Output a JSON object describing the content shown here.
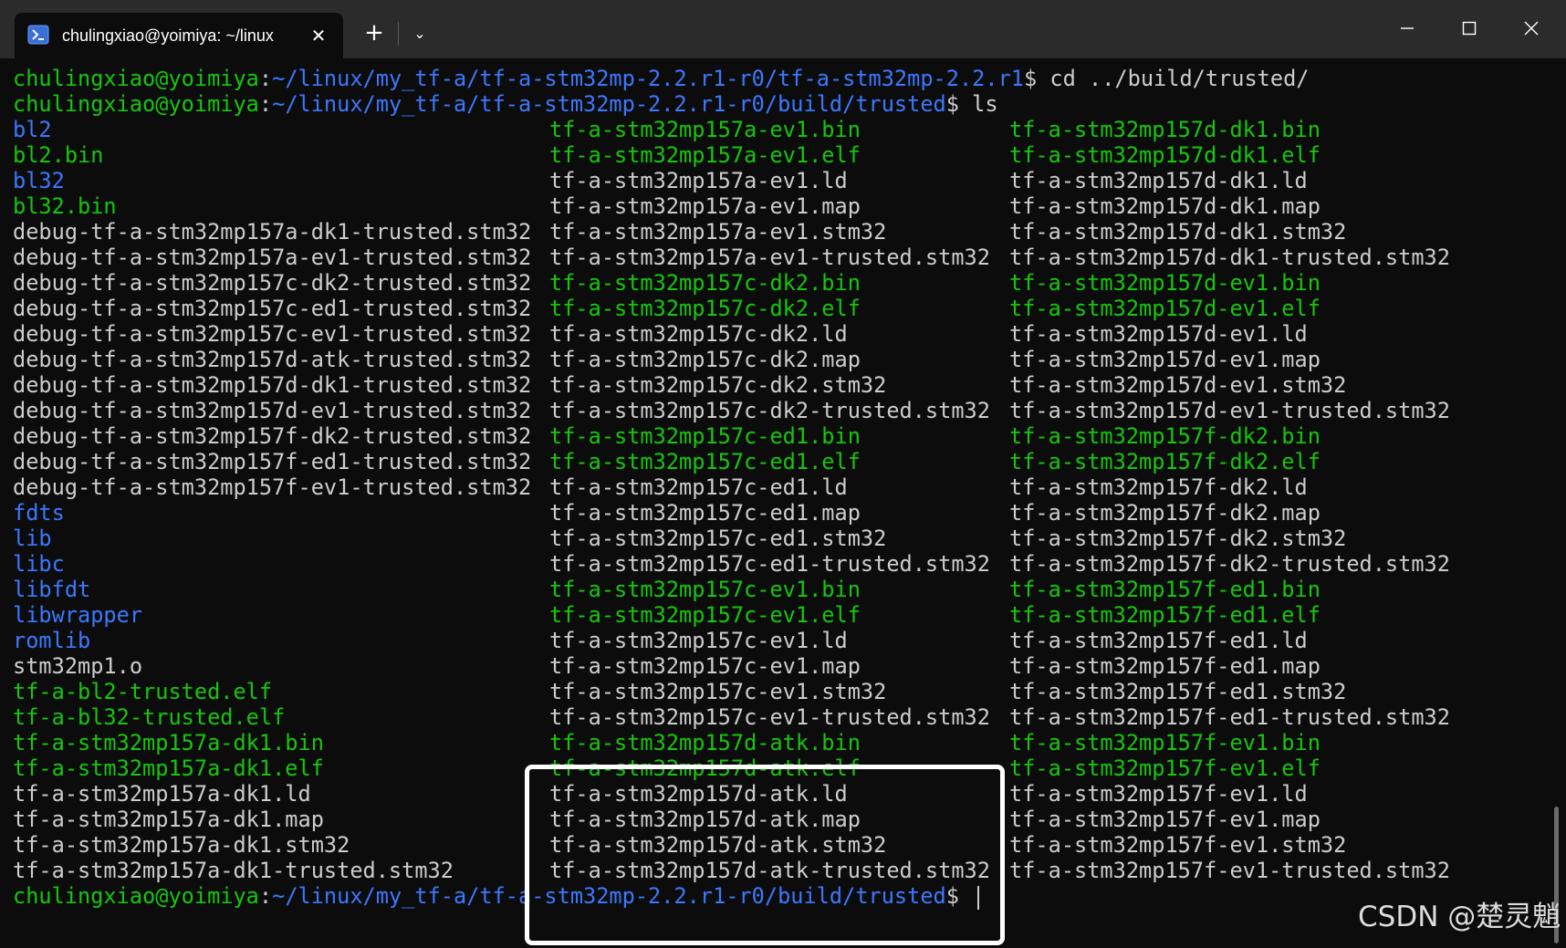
{
  "tab": {
    "title": "chulingxiao@yoimiya: ~/linux",
    "icon": "terminal-icon"
  },
  "titlebar": {
    "new_tab": "+",
    "dropdown": "⌄",
    "close_tab": "✕"
  },
  "colors": {
    "background": "#0c0c0c",
    "titlebar": "#2b2b2b",
    "text": "#cccccc",
    "user_host": "#16c60c",
    "path": "#3b78ff",
    "directory": "#3b78ff",
    "executable": "#16c60c",
    "highlight": "#ffffff"
  },
  "prompts": [
    {
      "user": "chulingxiao@yoimiya",
      "sep": ":",
      "path": "~/linux/my_tf-a/tf-a-stm32mp-2.2.r1-r0/tf-a-stm32mp-2.2.r1",
      "suffix": "$ cd ../build/trusted/"
    },
    {
      "user": "chulingxiao@yoimiya",
      "sep": ":",
      "path": "~/linux/my_tf-a/tf-a-stm32mp-2.2.r1-r0/build/trusted",
      "suffix": "$ ls"
    }
  ],
  "listing": [
    [
      {
        "name": "bl2",
        "kind": "dir"
      },
      {
        "name": "bl2.bin",
        "kind": "exe"
      },
      {
        "name": "bl32",
        "kind": "dir"
      },
      {
        "name": "bl32.bin",
        "kind": "exe"
      },
      {
        "name": "debug-tf-a-stm32mp157a-dk1-trusted.stm32",
        "kind": "file"
      },
      {
        "name": "debug-tf-a-stm32mp157a-ev1-trusted.stm32",
        "kind": "file"
      },
      {
        "name": "debug-tf-a-stm32mp157c-dk2-trusted.stm32",
        "kind": "file"
      },
      {
        "name": "debug-tf-a-stm32mp157c-ed1-trusted.stm32",
        "kind": "file"
      },
      {
        "name": "debug-tf-a-stm32mp157c-ev1-trusted.stm32",
        "kind": "file"
      },
      {
        "name": "debug-tf-a-stm32mp157d-atk-trusted.stm32",
        "kind": "file"
      },
      {
        "name": "debug-tf-a-stm32mp157d-dk1-trusted.stm32",
        "kind": "file"
      },
      {
        "name": "debug-tf-a-stm32mp157d-ev1-trusted.stm32",
        "kind": "file"
      },
      {
        "name": "debug-tf-a-stm32mp157f-dk2-trusted.stm32",
        "kind": "file"
      },
      {
        "name": "debug-tf-a-stm32mp157f-ed1-trusted.stm32",
        "kind": "file"
      },
      {
        "name": "debug-tf-a-stm32mp157f-ev1-trusted.stm32",
        "kind": "file"
      },
      {
        "name": "fdts",
        "kind": "dir"
      },
      {
        "name": "lib",
        "kind": "dir"
      },
      {
        "name": "libc",
        "kind": "dir"
      },
      {
        "name": "libfdt",
        "kind": "dir"
      },
      {
        "name": "libwrapper",
        "kind": "dir"
      },
      {
        "name": "romlib",
        "kind": "dir"
      },
      {
        "name": "stm32mp1.o",
        "kind": "file"
      },
      {
        "name": "tf-a-bl2-trusted.elf",
        "kind": "exe"
      },
      {
        "name": "tf-a-bl32-trusted.elf",
        "kind": "exe"
      },
      {
        "name": "tf-a-stm32mp157a-dk1.bin",
        "kind": "exe"
      },
      {
        "name": "tf-a-stm32mp157a-dk1.elf",
        "kind": "exe"
      },
      {
        "name": "tf-a-stm32mp157a-dk1.ld",
        "kind": "file"
      },
      {
        "name": "tf-a-stm32mp157a-dk1.map",
        "kind": "file"
      },
      {
        "name": "tf-a-stm32mp157a-dk1.stm32",
        "kind": "file"
      },
      {
        "name": "tf-a-stm32mp157a-dk1-trusted.stm32",
        "kind": "file"
      }
    ],
    [
      {
        "name": "tf-a-stm32mp157a-ev1.bin",
        "kind": "exe"
      },
      {
        "name": "tf-a-stm32mp157a-ev1.elf",
        "kind": "exe"
      },
      {
        "name": "tf-a-stm32mp157a-ev1.ld",
        "kind": "file"
      },
      {
        "name": "tf-a-stm32mp157a-ev1.map",
        "kind": "file"
      },
      {
        "name": "tf-a-stm32mp157a-ev1.stm32",
        "kind": "file"
      },
      {
        "name": "tf-a-stm32mp157a-ev1-trusted.stm32",
        "kind": "file"
      },
      {
        "name": "tf-a-stm32mp157c-dk2.bin",
        "kind": "exe"
      },
      {
        "name": "tf-a-stm32mp157c-dk2.elf",
        "kind": "exe"
      },
      {
        "name": "tf-a-stm32mp157c-dk2.ld",
        "kind": "file"
      },
      {
        "name": "tf-a-stm32mp157c-dk2.map",
        "kind": "file"
      },
      {
        "name": "tf-a-stm32mp157c-dk2.stm32",
        "kind": "file"
      },
      {
        "name": "tf-a-stm32mp157c-dk2-trusted.stm32",
        "kind": "file"
      },
      {
        "name": "tf-a-stm32mp157c-ed1.bin",
        "kind": "exe"
      },
      {
        "name": "tf-a-stm32mp157c-ed1.elf",
        "kind": "exe"
      },
      {
        "name": "tf-a-stm32mp157c-ed1.ld",
        "kind": "file"
      },
      {
        "name": "tf-a-stm32mp157c-ed1.map",
        "kind": "file"
      },
      {
        "name": "tf-a-stm32mp157c-ed1.stm32",
        "kind": "file"
      },
      {
        "name": "tf-a-stm32mp157c-ed1-trusted.stm32",
        "kind": "file"
      },
      {
        "name": "tf-a-stm32mp157c-ev1.bin",
        "kind": "exe"
      },
      {
        "name": "tf-a-stm32mp157c-ev1.elf",
        "kind": "exe"
      },
      {
        "name": "tf-a-stm32mp157c-ev1.ld",
        "kind": "file"
      },
      {
        "name": "tf-a-stm32mp157c-ev1.map",
        "kind": "file"
      },
      {
        "name": "tf-a-stm32mp157c-ev1.stm32",
        "kind": "file"
      },
      {
        "name": "tf-a-stm32mp157c-ev1-trusted.stm32",
        "kind": "file"
      },
      {
        "name": "tf-a-stm32mp157d-atk.bin",
        "kind": "exe"
      },
      {
        "name": "tf-a-stm32mp157d-atk.elf",
        "kind": "exe"
      },
      {
        "name": "tf-a-stm32mp157d-atk.ld",
        "kind": "file"
      },
      {
        "name": "tf-a-stm32mp157d-atk.map",
        "kind": "file"
      },
      {
        "name": "tf-a-stm32mp157d-atk.stm32",
        "kind": "file"
      },
      {
        "name": "tf-a-stm32mp157d-atk-trusted.stm32",
        "kind": "file"
      }
    ],
    [
      {
        "name": "tf-a-stm32mp157d-dk1.bin",
        "kind": "exe"
      },
      {
        "name": "tf-a-stm32mp157d-dk1.elf",
        "kind": "exe"
      },
      {
        "name": "tf-a-stm32mp157d-dk1.ld",
        "kind": "file"
      },
      {
        "name": "tf-a-stm32mp157d-dk1.map",
        "kind": "file"
      },
      {
        "name": "tf-a-stm32mp157d-dk1.stm32",
        "kind": "file"
      },
      {
        "name": "tf-a-stm32mp157d-dk1-trusted.stm32",
        "kind": "file"
      },
      {
        "name": "tf-a-stm32mp157d-ev1.bin",
        "kind": "exe"
      },
      {
        "name": "tf-a-stm32mp157d-ev1.elf",
        "kind": "exe"
      },
      {
        "name": "tf-a-stm32mp157d-ev1.ld",
        "kind": "file"
      },
      {
        "name": "tf-a-stm32mp157d-ev1.map",
        "kind": "file"
      },
      {
        "name": "tf-a-stm32mp157d-ev1.stm32",
        "kind": "file"
      },
      {
        "name": "tf-a-stm32mp157d-ev1-trusted.stm32",
        "kind": "file"
      },
      {
        "name": "tf-a-stm32mp157f-dk2.bin",
        "kind": "exe"
      },
      {
        "name": "tf-a-stm32mp157f-dk2.elf",
        "kind": "exe"
      },
      {
        "name": "tf-a-stm32mp157f-dk2.ld",
        "kind": "file"
      },
      {
        "name": "tf-a-stm32mp157f-dk2.map",
        "kind": "file"
      },
      {
        "name": "tf-a-stm32mp157f-dk2.stm32",
        "kind": "file"
      },
      {
        "name": "tf-a-stm32mp157f-dk2-trusted.stm32",
        "kind": "file"
      },
      {
        "name": "tf-a-stm32mp157f-ed1.bin",
        "kind": "exe"
      },
      {
        "name": "tf-a-stm32mp157f-ed1.elf",
        "kind": "exe"
      },
      {
        "name": "tf-a-stm32mp157f-ed1.ld",
        "kind": "file"
      },
      {
        "name": "tf-a-stm32mp157f-ed1.map",
        "kind": "file"
      },
      {
        "name": "tf-a-stm32mp157f-ed1.stm32",
        "kind": "file"
      },
      {
        "name": "tf-a-stm32mp157f-ed1-trusted.stm32",
        "kind": "file"
      },
      {
        "name": "tf-a-stm32mp157f-ev1.bin",
        "kind": "exe"
      },
      {
        "name": "tf-a-stm32mp157f-ev1.elf",
        "kind": "exe"
      },
      {
        "name": "tf-a-stm32mp157f-ev1.ld",
        "kind": "file"
      },
      {
        "name": "tf-a-stm32mp157f-ev1.map",
        "kind": "file"
      },
      {
        "name": "tf-a-stm32mp157f-ev1.stm32",
        "kind": "file"
      },
      {
        "name": "tf-a-stm32mp157f-ev1-trusted.stm32",
        "kind": "file"
      }
    ]
  ],
  "final_prompt": {
    "user": "chulingxiao@yoimiya",
    "sep": ":",
    "path": "~/linux/my_tf-a/tf-a-stm32mp-2.2.r1-r0/build/trusted",
    "suffix": "$ "
  },
  "watermark": "CSDN @楚灵魈"
}
